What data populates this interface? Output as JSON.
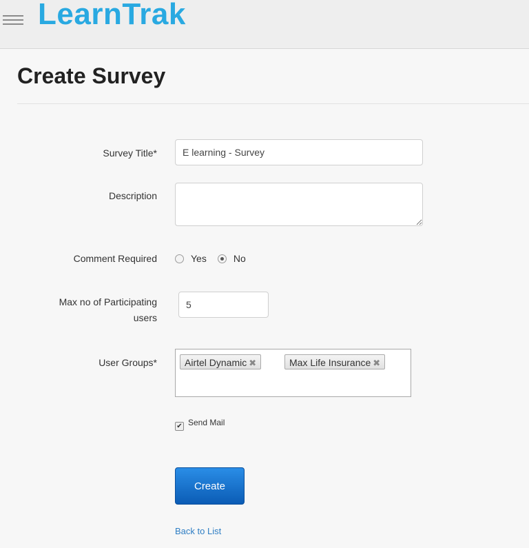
{
  "app": {
    "brand": "LearnTrak"
  },
  "page": {
    "title": "Create Survey"
  },
  "form": {
    "survey_title": {
      "label": "Survey Title*",
      "value": "E learning - Survey"
    },
    "description": {
      "label": "Description",
      "value": ""
    },
    "comment_required": {
      "label": "Comment Required",
      "options": [
        {
          "label": "Yes",
          "checked": false
        },
        {
          "label": "No",
          "checked": true
        }
      ]
    },
    "max_participants": {
      "label_line1": "Max no of Participating",
      "label_line2": "users",
      "value": "5"
    },
    "user_groups": {
      "label": "User Groups*",
      "tags": [
        {
          "label": "Airtel Dynamic",
          "remove": "✖"
        },
        {
          "label": "Max Life Insurance",
          "remove": "✖"
        }
      ]
    },
    "send_mail": {
      "label": "Send Mail",
      "checked": true
    },
    "create_button": "Create",
    "back_link": "Back to List"
  },
  "icons": {
    "menu": "hamburger-icon",
    "checkmark": "✔"
  },
  "colors": {
    "brand": "#29a9e1",
    "button": "#0b5cb5",
    "link": "#2f7ec4"
  }
}
